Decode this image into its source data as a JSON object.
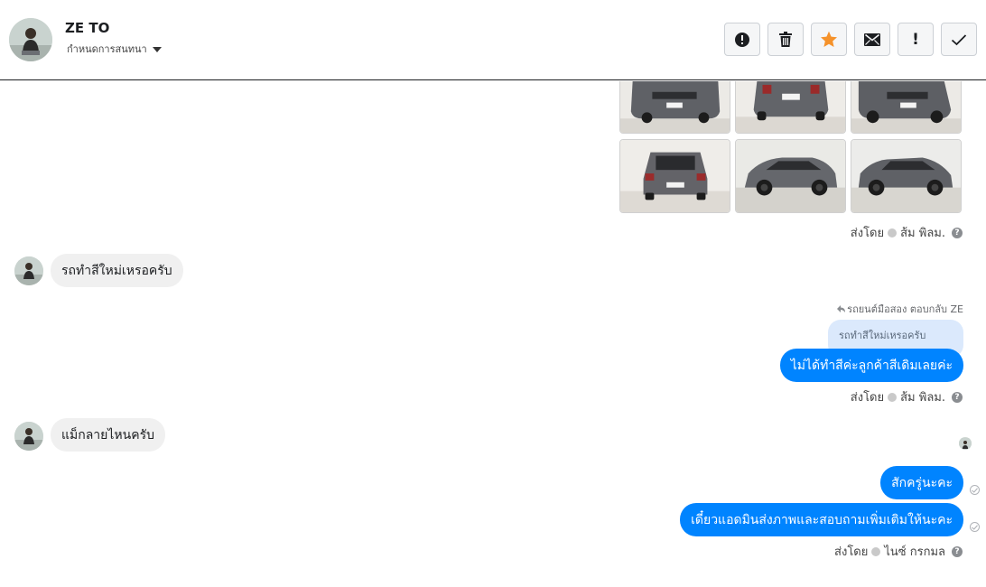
{
  "header": {
    "contact_name": "ZE TO",
    "assign_label": "กำหนดการสนทนา",
    "actions": [
      {
        "name": "report-button",
        "icon": "alert-circle-icon"
      },
      {
        "name": "delete-button",
        "icon": "trash-icon"
      },
      {
        "name": "star-button",
        "icon": "star-icon"
      },
      {
        "name": "mark-unread-button",
        "icon": "envelope-icon"
      },
      {
        "name": "important-button",
        "icon": "exclamation-icon",
        "glyph": "!"
      },
      {
        "name": "done-button",
        "icon": "checkmark-icon"
      }
    ]
  },
  "colors": {
    "outgoing_bubble": "#0084ff",
    "incoming_bubble": "#f0f0f0",
    "quoted_bubble": "#dbe9fc",
    "star": "#f5922b"
  },
  "messages": {
    "photos_sent_by": {
      "prefix": "ส่งโดย",
      "name": "ส้ม พิลม.",
      "help": "?"
    },
    "incoming_1": "รถทำสีใหม่เหรอครับ",
    "reply_note": "รถยนต์มือสอง ตอบกลับ ZE",
    "quoted_text": "รถทำสีใหม่เหรอครับ",
    "outgoing_1": "ไม่ได้ทำสีค่ะลูกค้าสีเดิมเลยค่ะ",
    "outgoing_1_sent_by": {
      "prefix": "ส่งโดย",
      "name": "ส้ม พิลม.",
      "help": "?"
    },
    "incoming_2": "แม็กลายไหนครับ",
    "outgoing_2": "สักครู่นะคะ",
    "outgoing_3": "เดี๋ยวแอดมินส่งภาพและสอบถามเพิ่มเติมให้นะคะ",
    "outgoing_3_sent_by": {
      "prefix": "ส่งโดย",
      "name": "ไนซ์ กรกมล",
      "help": "?"
    }
  }
}
